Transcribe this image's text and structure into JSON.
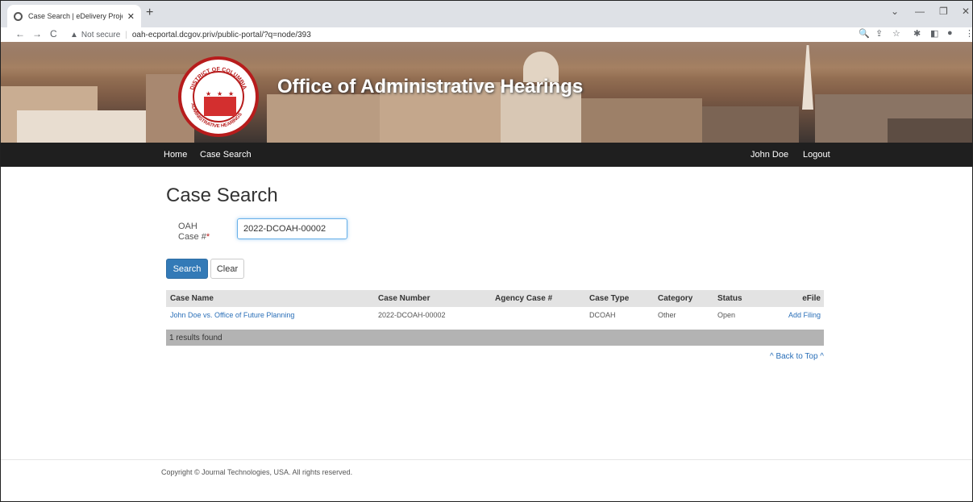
{
  "browser": {
    "tab_title": "Case Search | eDelivery Project",
    "tab_close": "✕",
    "new_tab": "+",
    "window_controls": [
      "⌄",
      "—",
      "❐",
      "✕"
    ],
    "back": "←",
    "forward": "→",
    "reload": "C",
    "security_icon": "▲",
    "security_label": "Not secure",
    "separator": "|",
    "url": "oah-ecportal.dcgov.priv/public-portal/?q=node/393",
    "toolbar_icons": [
      "🔍",
      "⇪",
      "☆",
      "✱",
      "◧",
      "●",
      "⋮"
    ]
  },
  "banner": {
    "title": "Office of Administrative Hearings",
    "seal_top": "DISTRICT OF COLUMBIA",
    "seal_left": "OFFICE OF",
    "seal_bottom": "ADMINISTRATIVE HEARINGS"
  },
  "nav": {
    "home": "Home",
    "case_search": "Case Search",
    "user": "John Doe",
    "logout": "Logout"
  },
  "page": {
    "heading": "Case Search",
    "field_label_1": "OAH",
    "field_label_2": "Case #",
    "required_mark": "*",
    "case_number_value": "2022-DCOAH-00002",
    "search_button": "Search",
    "clear_button": "Clear"
  },
  "table": {
    "headers": [
      "Case Name",
      "Case Number",
      "Agency Case #",
      "Case Type",
      "Category",
      "Status",
      "eFile"
    ],
    "rows": [
      {
        "case_name": "John Doe vs. Office of Future Planning",
        "case_number": "2022-DCOAH-00002",
        "agency_case": "",
        "case_type": "DCOAH",
        "category": "Other",
        "status": "Open",
        "efile": "Add Filing"
      }
    ],
    "results_text": "1 results found"
  },
  "back_to_top": "^ Back to Top ^",
  "footer": {
    "copyright": "Copyright © Journal Technologies, USA. All rights reserved."
  }
}
